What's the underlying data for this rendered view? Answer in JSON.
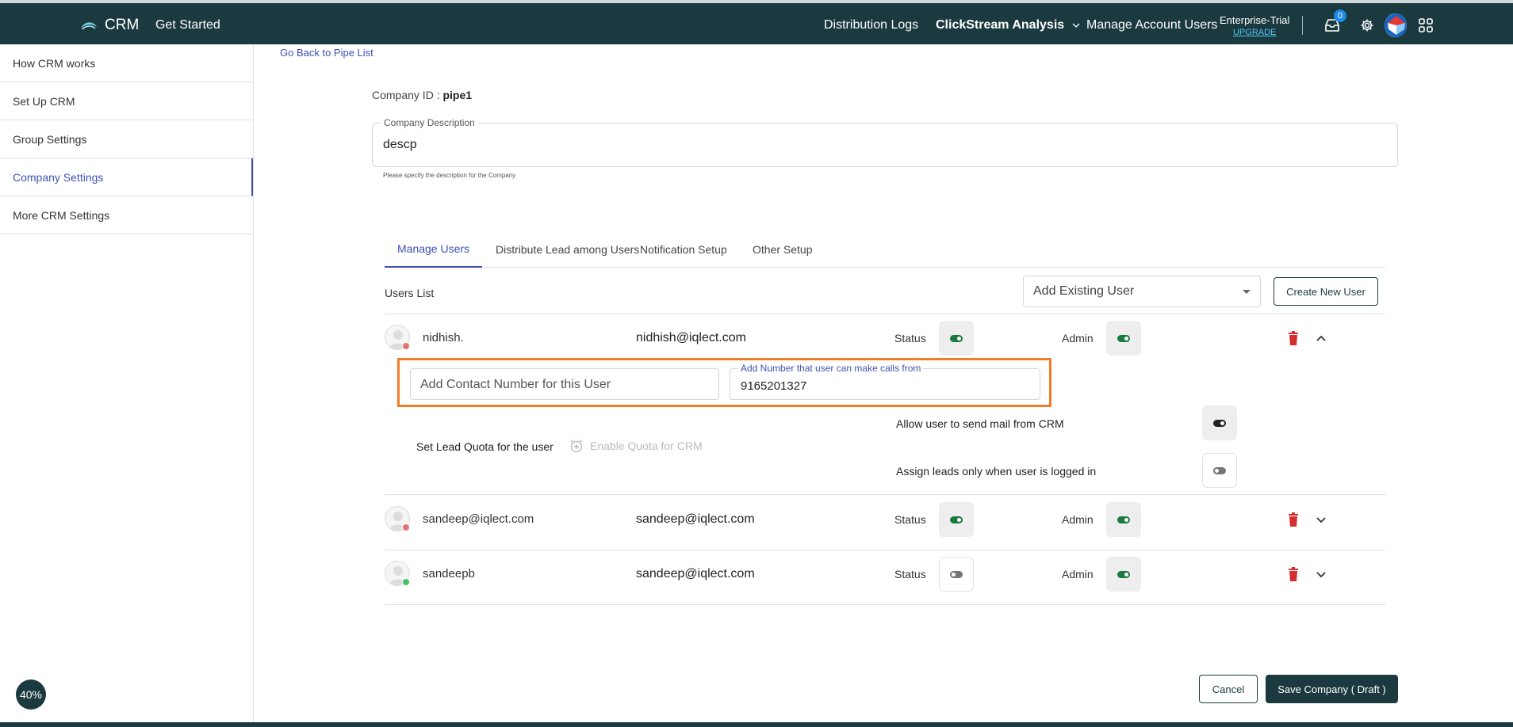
{
  "header": {
    "app_name": "CRM",
    "get_started": "Get Started",
    "nav": {
      "distribution_logs": "Distribution Logs",
      "clickstream": "ClickStream Analysis",
      "manage_account_users": "Manage Account Users"
    },
    "plan": {
      "name": "Enterprise-Trial",
      "upgrade": "UPGRADE"
    },
    "inbox_count": "0"
  },
  "sidebar": {
    "items": [
      {
        "label": "How CRM works"
      },
      {
        "label": "Set Up CRM"
      },
      {
        "label": "Group Settings"
      },
      {
        "label": "Company Settings"
      },
      {
        "label": "More CRM Settings"
      }
    ],
    "active_index": 3
  },
  "page": {
    "back_link": "Go Back to Pipe List",
    "company_id_label": "Company ID :",
    "company_id_value": "pipe1",
    "description": {
      "label": "Company Description",
      "value": "descp",
      "helper": "Please specify the description for the Company"
    }
  },
  "tabs": [
    {
      "label": "Manage Users"
    },
    {
      "label": "Distribute Lead among Users"
    },
    {
      "label": "Notification Setup"
    },
    {
      "label": "Other Setup"
    }
  ],
  "users_section": {
    "title": "Users List",
    "add_existing_placeholder": "Add Existing User",
    "create_new": "Create New User",
    "status_label": "Status",
    "admin_label": "Admin"
  },
  "users": [
    {
      "name": "nidhish.",
      "email": "nidhish@iqlect.com",
      "status_on": true,
      "admin_on": true,
      "presence": "offline",
      "expanded": true
    },
    {
      "name": "sandeep@iqlect.com",
      "email": "sandeep@iqlect.com",
      "status_on": true,
      "admin_on": true,
      "presence": "offline",
      "expanded": false
    },
    {
      "name": "sandeepb",
      "email": "sandeep@iqlect.com",
      "status_on": false,
      "admin_on": true,
      "presence": "online",
      "expanded": false
    }
  ],
  "expanded_user": {
    "contact_placeholder": "Add Contact Number for this User",
    "call_from_label": "Add Number that user can make calls from",
    "call_from_value": "9165201327",
    "quota_label": "Set Lead Quota for the user",
    "quota_button": "Enable Quota for CRM",
    "allow_mail_label": "Allow user to send mail from CRM",
    "allow_mail_on": true,
    "assign_logged_in_label": "Assign leads only when user is logged in",
    "assign_logged_in_on": false
  },
  "footer": {
    "cancel": "Cancel",
    "save": "Save Company ( Draft )",
    "progress": "40%"
  },
  "colors": {
    "header_bg": "#1b3a3f",
    "accent": "#3f51b5",
    "toggle_on": "#1b7a3e",
    "toggle_off": "#757575",
    "danger": "#d32f2f",
    "highlight": "#ef7d29",
    "online": "#43c463",
    "offline": "#e57373"
  }
}
